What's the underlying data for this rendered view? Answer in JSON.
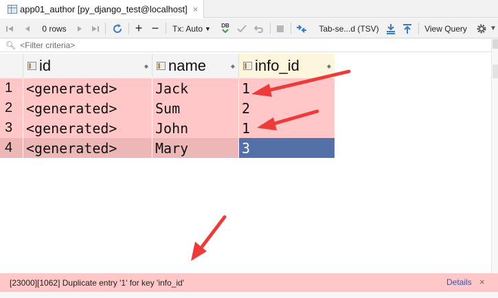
{
  "tab": {
    "title": "app01_author [py_django_test@localhost]",
    "close": "×"
  },
  "toolbar": {
    "rows_label": "0 rows",
    "tx_label": "Tx: Auto",
    "db_label": "DB",
    "export_label": "Tab-se...d (TSV)",
    "view_query_label": "View Query"
  },
  "filter": {
    "placeholder": "<Filter criteria>"
  },
  "table": {
    "columns": [
      "id",
      "name",
      "info_id"
    ],
    "rows": [
      {
        "num": "1",
        "id": "<generated>",
        "name": "Jack",
        "info_id": "1"
      },
      {
        "num": "2",
        "id": "<generated>",
        "name": "Sum",
        "info_id": "2"
      },
      {
        "num": "3",
        "id": "<generated>",
        "name": "John",
        "info_id": "1"
      },
      {
        "num": "4",
        "id": "<generated>",
        "name": "Mary",
        "info_id": "3"
      }
    ]
  },
  "status": {
    "message": "[23000][1062] Duplicate entry '1' for key 'info_id'",
    "details": "Details",
    "close": "×"
  },
  "colors": {
    "error_row": "#ffc7c7",
    "selected_cell": "#5470a8",
    "annotation_arrow": "#ef3a3a",
    "link": "#2a55c8"
  }
}
